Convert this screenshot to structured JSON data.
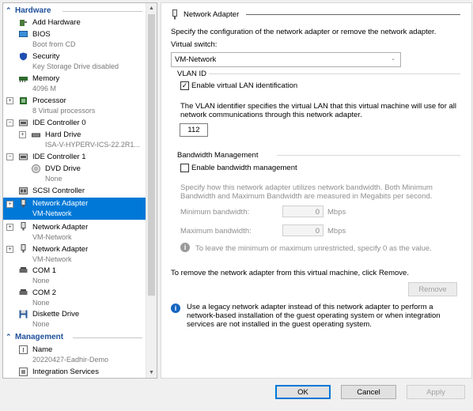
{
  "tree": {
    "hardware_header": "Hardware",
    "management_header": "Management",
    "items": [
      {
        "label": "Add Hardware",
        "sub": ""
      },
      {
        "label": "BIOS",
        "sub": "Boot from CD"
      },
      {
        "label": "Security",
        "sub": "Key Storage Drive disabled"
      },
      {
        "label": "Memory",
        "sub": "4096 M"
      },
      {
        "label": "Processor",
        "sub": "8 Virtual processors"
      },
      {
        "label": "IDE Controller 0",
        "sub": ""
      },
      {
        "label": "Hard Drive",
        "sub": "ISA-V-HYPERV-ICS-22.2R1..."
      },
      {
        "label": "IDE Controller 1",
        "sub": ""
      },
      {
        "label": "DVD Drive",
        "sub": "None"
      },
      {
        "label": "SCSI Controller",
        "sub": ""
      },
      {
        "label": "Network Adapter",
        "sub": "VM-Network"
      },
      {
        "label": "Network Adapter",
        "sub": "VM-Network"
      },
      {
        "label": "Network Adapter",
        "sub": "VM-Network"
      },
      {
        "label": "COM 1",
        "sub": "None"
      },
      {
        "label": "COM 2",
        "sub": "None"
      },
      {
        "label": "Diskette Drive",
        "sub": "None"
      },
      {
        "label": "Name",
        "sub": "20220427-Eadhir-Demo"
      },
      {
        "label": "Integration Services",
        "sub": ""
      }
    ],
    "selected_index": 10
  },
  "panel": {
    "title": "Network Adapter",
    "desc": "Specify the configuration of the network adapter or remove the network adapter.",
    "vswitch_label": "Virtual switch:",
    "vswitch_value": "VM-Network",
    "vlan_title": "VLAN ID",
    "vlan_checkbox_label": "Enable virtual LAN identification",
    "vlan_checked": true,
    "vlan_desc_1": "The VLAN identifier specifies the virtual LAN that this virtual machine will use for all",
    "vlan_desc_2": "network communications through this network adapter.",
    "vlan_value": "112",
    "bw_title": "Bandwidth Management",
    "bw_checkbox_label": "Enable bandwidth management",
    "bw_checked": false,
    "bw_desc_1": "Specify how this network adapter utilizes network bandwidth. Both Minimum",
    "bw_desc_2": "Bandwidth and Maximum Bandwidth are measured in Megabits per second.",
    "min_label": "Minimum bandwidth:",
    "min_value": "0",
    "max_label": "Maximum bandwidth:",
    "max_value": "0",
    "unit": "Mbps",
    "bw_hint": "To leave the minimum or maximum unrestricted, specify 0 as the value.",
    "remove_text": "To remove the network adapter from this virtual machine, click Remove.",
    "remove_button": "Remove",
    "legacy_1": "Use a legacy network adapter instead of this network adapter to perform a",
    "legacy_2": "network-based installation of the guest operating system or when integration",
    "legacy_3": "services are not installed in the guest operating system."
  },
  "buttons": {
    "ok": "OK",
    "cancel": "Cancel",
    "apply": "Apply"
  },
  "colors": {
    "accent": "#0078d7",
    "header": "#1e4f99"
  }
}
